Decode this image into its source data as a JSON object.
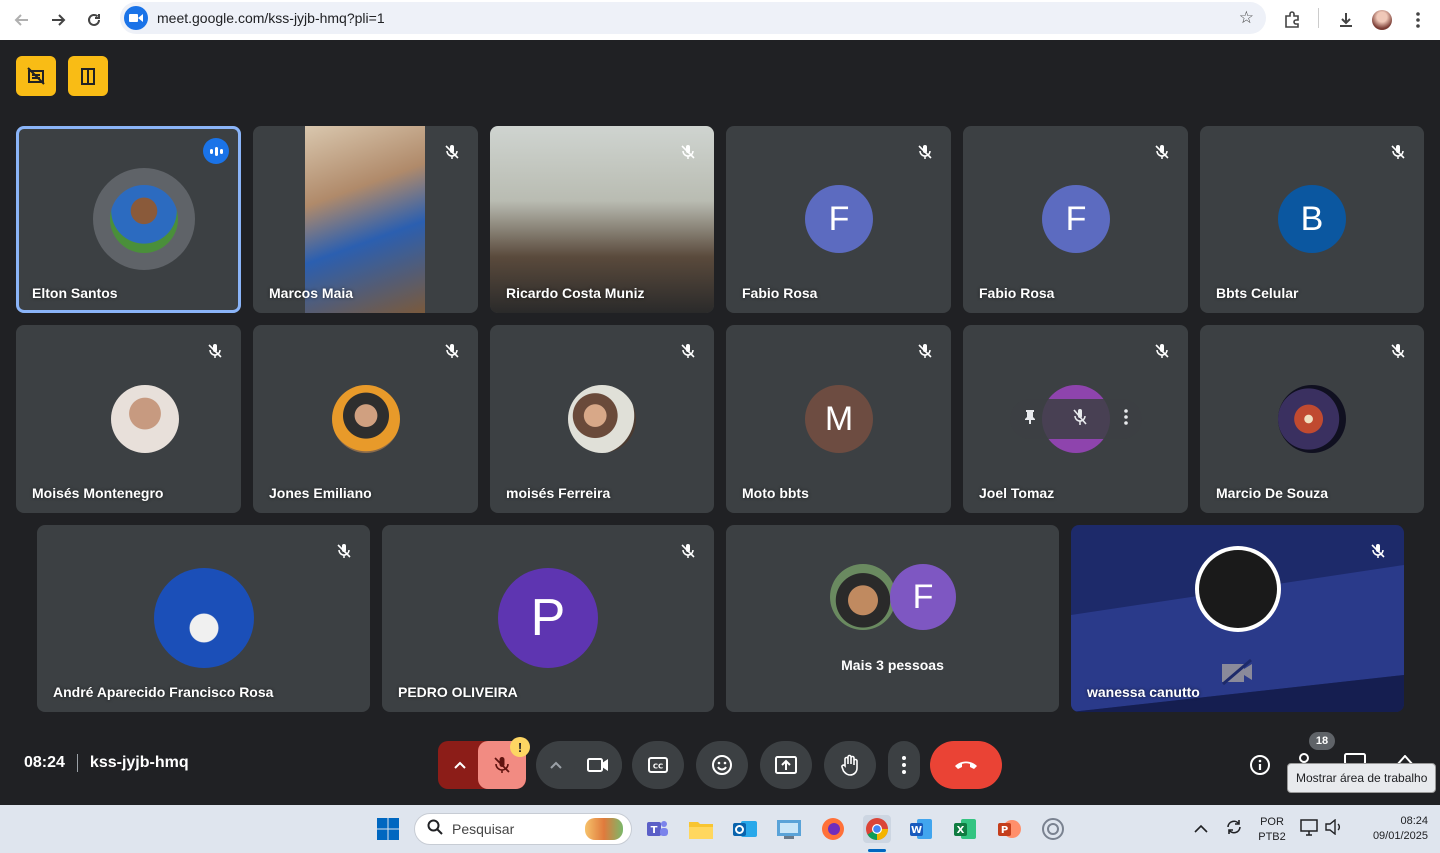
{
  "browser": {
    "url": "meet.google.com/kss-jyjb-hmq?pli=1"
  },
  "participants_row1": [
    {
      "name": "Elton Santos"
    },
    {
      "name": "Marcos Maia"
    },
    {
      "name": "Ricardo Costa Muniz"
    },
    {
      "name": "Fabio Rosa",
      "initial": "F"
    },
    {
      "name": "Fabio Rosa",
      "initial": "F"
    },
    {
      "name": "Bbts Celular",
      "initial": "B"
    }
  ],
  "participants_row2": [
    {
      "name": "Moisés Montenegro"
    },
    {
      "name": "Jones Emiliano"
    },
    {
      "name": "moisés Ferreira"
    },
    {
      "name": "Moto bbts",
      "initial": "M"
    },
    {
      "name": "Joel Tomaz"
    },
    {
      "name": "Marcio De Souza"
    }
  ],
  "participants_row3": [
    {
      "name": "André Aparecido Francisco Rosa"
    },
    {
      "name": "PEDRO OLIVEIRA",
      "initial": "P"
    },
    {
      "name": "Mais 3 pessoas",
      "initial": "F"
    },
    {
      "name": "wanessa canutto"
    }
  ],
  "meeting": {
    "time": "08:24",
    "code": "kss-jyjb-hmq",
    "people_count": "18",
    "tooltip": "Mostrar área de trabalho",
    "warning_badge": "!"
  },
  "taskbar": {
    "search_placeholder": "Pesquisar",
    "lang_line1": "POR",
    "lang_line2": "PTB2",
    "clock_time": "08:24",
    "clock_date": "09/01/2025"
  },
  "colors": {
    "bg": "#202124",
    "tile": "#3c4043",
    "active_border": "#8ab4f8",
    "end_call": "#ea4335",
    "mic_muted": "#f28b82"
  }
}
